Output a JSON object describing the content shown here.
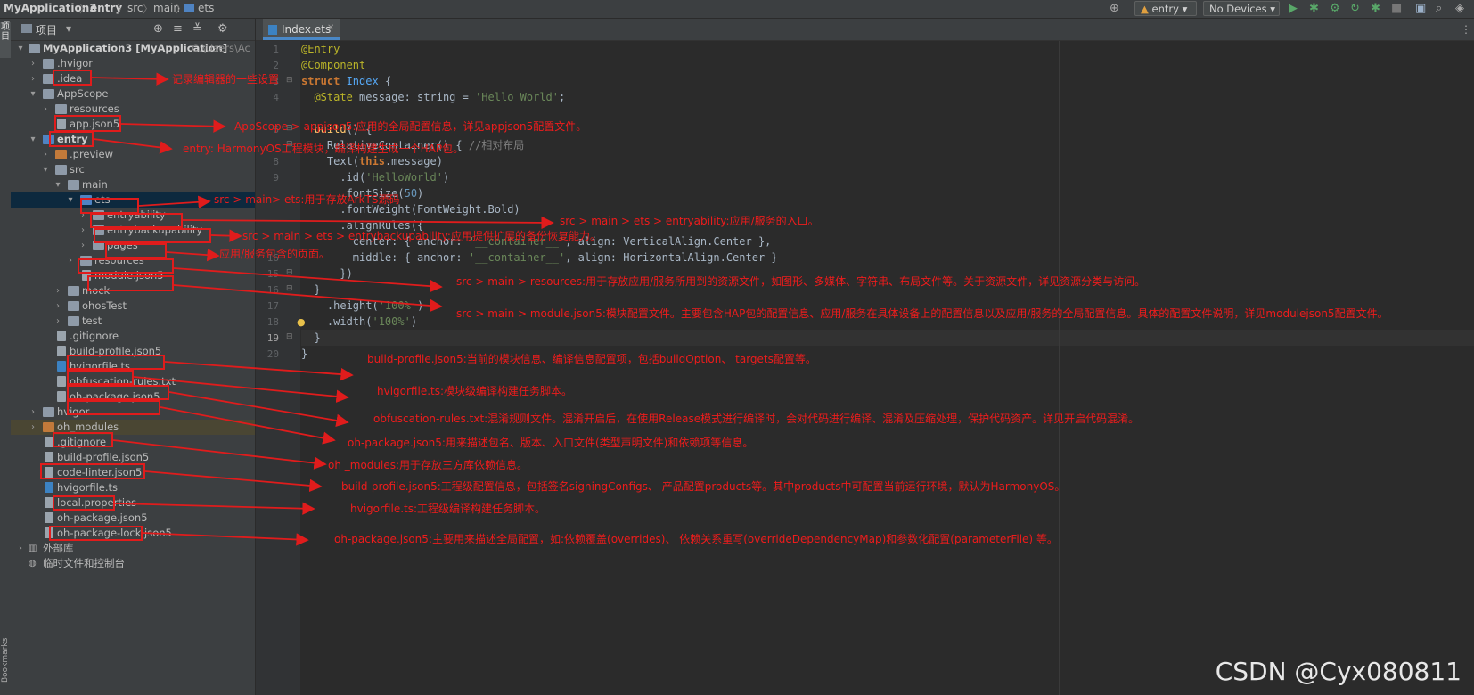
{
  "breadcrumb": [
    "MyApplication3",
    "entry",
    "src",
    "main",
    "ets"
  ],
  "toolbar": {
    "module": "entry",
    "device": "No Devices"
  },
  "project_panel": {
    "title": "项目",
    "side_label": "项目",
    "bookmarks_label": "Bookmarks"
  },
  "editor_tab": "Index.ets",
  "tree": [
    {
      "label": "MyApplication3 [MyApplication]",
      "extra": "C:\\Users\\Ac"
    },
    {
      "label": ".hvigor"
    },
    {
      "label": ".idea"
    },
    {
      "label": "AppScope"
    },
    {
      "label": "resources"
    },
    {
      "label": "app.json5"
    },
    {
      "label": "entry"
    },
    {
      "label": ".preview"
    },
    {
      "label": "src"
    },
    {
      "label": "main"
    },
    {
      "label": "ets"
    },
    {
      "label": "entryability"
    },
    {
      "label": "entrybackupability"
    },
    {
      "label": "pages"
    },
    {
      "label": "resources"
    },
    {
      "label": "module.json5"
    },
    {
      "label": "mock"
    },
    {
      "label": "ohosTest"
    },
    {
      "label": "test"
    },
    {
      "label": ".gitignore"
    },
    {
      "label": "build-profile.json5"
    },
    {
      "label": "hvigorfile.ts"
    },
    {
      "label": "obfuscation-rules.txt"
    },
    {
      "label": "oh-package.json5"
    },
    {
      "label": "hvigor"
    },
    {
      "label": "oh_modules"
    },
    {
      "label": ".gitignore"
    },
    {
      "label": "build-profile.json5"
    },
    {
      "label": "code-linter.json5"
    },
    {
      "label": "hvigorfile.ts"
    },
    {
      "label": "local.properties"
    },
    {
      "label": "oh-package.json5"
    },
    {
      "label": "oh-package-lock.json5"
    },
    {
      "label": "外部库"
    },
    {
      "label": "临时文件和控制台"
    }
  ],
  "line_numbers": [
    "1",
    "2",
    "3",
    "4",
    "",
    "6",
    "",
    "8",
    "9",
    "",
    "",
    "",
    "",
    "16",
    "15",
    "16",
    "17",
    "18",
    "19",
    "20"
  ],
  "code": {
    "l1": "@Entry",
    "l2": "@Component",
    "l3a": "struct",
    "l3b": " Index ",
    "l3c": "{",
    "l4a": "  @State",
    "l4b": " message: string = ",
    "l4c": "'Hello World'",
    "l4d": ";",
    "l6a": "  build",
    "l6b": "() {",
    "l7a": "    RelativeContainer",
    "l7b": "() { ",
    "l7c": "//相对布局",
    "l8a": "    Text(",
    "l8b": "this",
    "l8c": ".message)",
    "l9a": "      .id(",
    "l9b": "'HelloWorld'",
    "l9c": ")",
    "l10a": "      .fontSize(",
    "l10b": "50",
    "l10c": ")",
    "l11": "      .fontWeight(FontWeight.Bold)",
    "l12": "      .alignRules({",
    "l13a": "        center: { anchor: ",
    "l13b": "'__container__'",
    "l13c": ", align: VerticalAlign.Center },",
    "l14a": "        middle: { anchor: ",
    "l14b": "'__container__'",
    "l14c": ", align: HorizontalAlign.Center }",
    "l15": "      })",
    "l16": "  }",
    "l17a": "    .height(",
    "l17b": "'100%'",
    "l17c": ")",
    "l18a": "    .width(",
    "l18b": "'100%'",
    "l18c": ")",
    "l19": "  }",
    "l20": "}"
  },
  "annotations": [
    "记录编辑器的一些设置",
    "AppScope > appjson5:应用的全局配置信息，详见appjson5配置文件。",
    "entry: HarmonyOS工程模块，编译构建生成一个HAP包。",
    "src > main> ets:用于存放ArkTS源码",
    "src > main > ets > entryability:应用/服务的入口。",
    "src > main > ets > entrybackupability:应用提供扩展的备份恢复能力。",
    "应用/服务包含的页面。",
    "src > main > resources:用于存放应用/服务所用到的资源文件，如图形、多媒体、字符串、布局文件等。关于资源文件，详见资源分类与访问。",
    "src > main > module.json5:模块配置文件。主要包含HAP包的配置信息、应用/服务在具体设备上的配置信息以及应用/服务的全局配置信息。具体的配置文件说明，详见modulejson5配置文件。",
    "build-profile.json5:当前的模块信息、编译信息配置项，包括buildOption、 targets配置等。",
    "hvigorfile.ts:模块级编译构建任务脚本。",
    "obfuscation-rules.txt:混淆规则文件。混淆开启后，在使用Release模式进行编译时，会对代码进行编译、混淆及压缩处理，保护代码资产。详见开启代码混淆。",
    "oh-package.json5:用来描述包名、版本、入口文件(类型声明文件)和依赖项等信息。",
    "oh _modules:用于存放三方库依赖信息。",
    "build-profile.json5:工程级配置信息，包括签名signingConfigs、 产品配置products等。其中products中可配置当前运行环境，默认为HarmonyOS。",
    "hvigorfile.ts:工程级编译构建任务脚本。",
    "oh-package.json5:主要用来描述全局配置，如:依赖覆盖(overrides)、 依赖关系重写(overrideDependencyMap)和参数化配置(parameterFile) 等。"
  ],
  "watermark": "CSDN @Cyx080811",
  "colors": {
    "annotation": "#e01c1c",
    "selection": "#0d293e",
    "editor_bg": "#2b2b2b",
    "panel_bg": "#3c3f41"
  }
}
